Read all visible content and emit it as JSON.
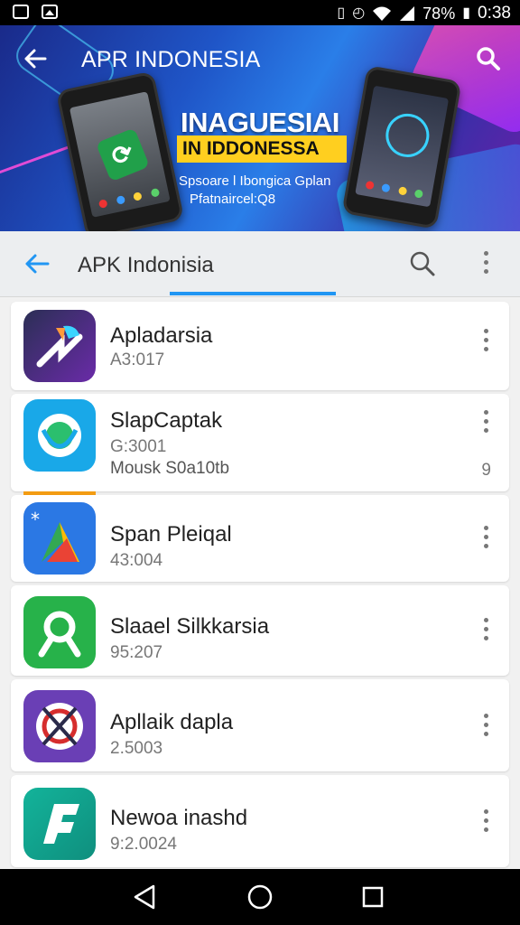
{
  "status_bar": {
    "battery": "78%",
    "time": "0:38"
  },
  "banner": {
    "title": "APR INDONESIA",
    "headline": "INAGUESIAI",
    "tag": "IN IDDONESSA",
    "sub1": "Spsoare l Ibongica Gplan",
    "sub2": "Pfatnaircel:Q8"
  },
  "toolbar": {
    "title": "APK Indonisia"
  },
  "apps": [
    {
      "name": "Apladarsia",
      "version": "A3:017"
    },
    {
      "name": "SlapCaptak",
      "version": "G:3001",
      "extra": "Mousk S0a10tb",
      "right": "9"
    },
    {
      "name": "Span Pleiqal",
      "version": "43:004"
    },
    {
      "name": "Slaael Silkkarsia",
      "version": "95:207"
    },
    {
      "name": "Apllaik dapla",
      "version": "2.5003"
    },
    {
      "name": "Newoa inashd",
      "version": "9:2.0024"
    }
  ]
}
